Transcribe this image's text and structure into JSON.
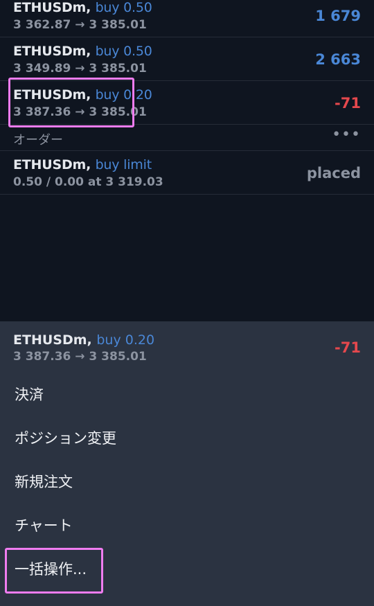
{
  "positions": [
    {
      "symbol": "ETHUSDm,",
      "side": "buy 0.50",
      "prices": "3 362.87 → 3 385.01",
      "pl": "1 679"
    },
    {
      "symbol": "ETHUSDm,",
      "side": "buy 0.50",
      "prices": "3 349.89 → 3 385.01",
      "pl": "2 663"
    },
    {
      "symbol": "ETHUSDm,",
      "side": "buy 0.20",
      "prices": "3 387.36 → 3 385.01",
      "pl": "-71"
    }
  ],
  "orders_section": {
    "label": "オーダー",
    "more": "•••"
  },
  "orders": [
    {
      "symbol": "ETHUSDm,",
      "side": "buy limit",
      "detail": "0.50 / 0.00 at 3 319.03",
      "status": "placed"
    }
  ],
  "sheet": {
    "symbol": "ETHUSDm,",
    "side": "buy 0.20",
    "prices": "3 387.36 → 3 385.01",
    "pl": "-71",
    "menu": [
      "決済",
      "ポジション変更",
      "新規注文",
      "チャート",
      "一括操作..."
    ]
  },
  "colors": {
    "background": "#0f1520",
    "sheet": "#2b3341",
    "buy": "#4a87d6",
    "loss": "#e5484d",
    "muted": "#8c93a0",
    "highlight": "#f07cf0"
  }
}
